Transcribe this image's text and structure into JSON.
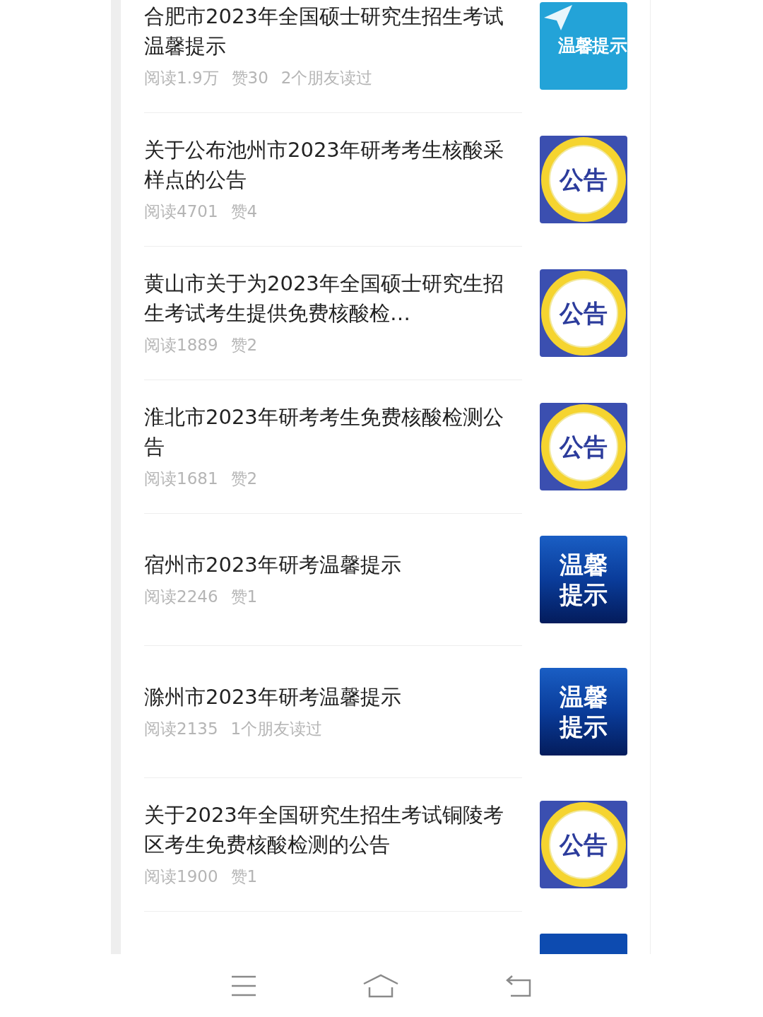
{
  "articles": [
    {
      "title": "合肥市2023年全国硕士研究生招生考试温馨提示",
      "meta": [
        "阅读1.9万",
        "赞30",
        "2个朋友读过"
      ],
      "thumb": {
        "kind": "plane",
        "label": "温馨提示"
      }
    },
    {
      "title": "关于公布池州市2023年研考考生核酸采样点的公告",
      "meta": [
        "阅读4701",
        "赞4"
      ],
      "thumb": {
        "kind": "notice",
        "label": "公告"
      }
    },
    {
      "title": "黄山市关于为2023年全国硕士研究生招生考试考生提供免费核酸检…",
      "meta": [
        "阅读1889",
        "赞2"
      ],
      "thumb": {
        "kind": "notice",
        "label": "公告"
      }
    },
    {
      "title": "淮北市2023年研考考生免费核酸检测公告",
      "meta": [
        "阅读1681",
        "赞2"
      ],
      "thumb": {
        "kind": "notice",
        "label": "公告"
      }
    },
    {
      "title": "宿州市2023年研考温馨提示",
      "meta": [
        "阅读2246",
        "赞1"
      ],
      "thumb": {
        "kind": "tip",
        "label": "温馨提示"
      }
    },
    {
      "title": "滁州市2023年研考温馨提示",
      "meta": [
        "阅读2135",
        "1个朋友读过"
      ],
      "thumb": {
        "kind": "tip",
        "label": "温馨提示"
      }
    },
    {
      "title": "关于2023年全国研究生招生考试铜陵考区考生免费核酸检测的公告",
      "meta": [
        "阅读1900",
        "赞1"
      ],
      "thumb": {
        "kind": "notice",
        "label": "公告"
      }
    }
  ]
}
